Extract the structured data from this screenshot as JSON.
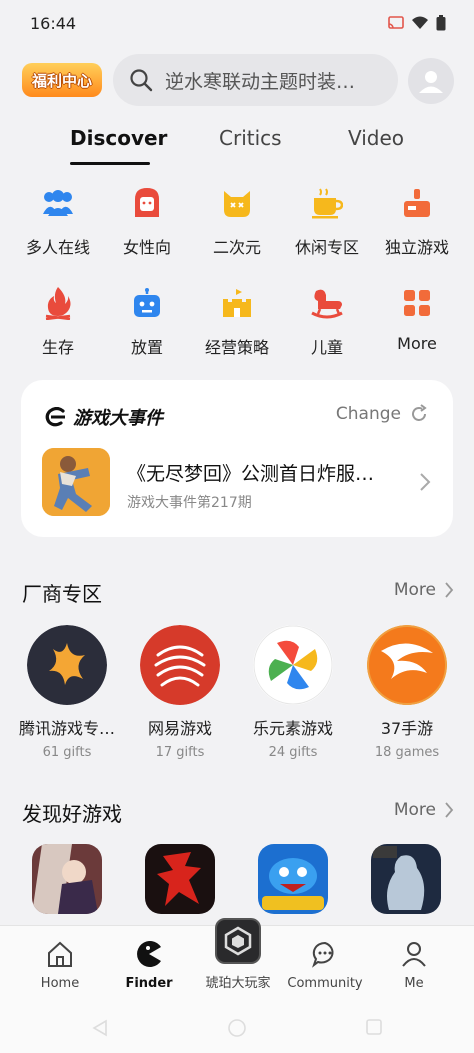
{
  "status": {
    "time": "16:44"
  },
  "header": {
    "welfare_label": "福利中心",
    "search_placeholder": "逆水寒联动主题时装…"
  },
  "tabs": [
    {
      "label": "Discover",
      "active": true
    },
    {
      "label": "Critics",
      "active": false
    },
    {
      "label": "Video",
      "active": false
    }
  ],
  "categories": [
    {
      "label": "多人在线",
      "icon": "people-icon",
      "color": "#2f86ee"
    },
    {
      "label": "女性向",
      "icon": "girl-icon",
      "color": "#e94b3c"
    },
    {
      "label": "二次元",
      "icon": "cat-icon",
      "color": "#f6b81c"
    },
    {
      "label": "休闲专区",
      "icon": "cup-icon",
      "color": "#f6b81c"
    },
    {
      "label": "独立游戏",
      "icon": "joystick-icon",
      "color": "#f26b3a"
    },
    {
      "label": "生存",
      "icon": "fire-icon",
      "color": "#e94b3c"
    },
    {
      "label": "放置",
      "icon": "robot-icon",
      "color": "#2f86ee"
    },
    {
      "label": "经营策略",
      "icon": "castle-icon",
      "color": "#f6b81c"
    },
    {
      "label": "儿童",
      "icon": "rocking-horse-icon",
      "color": "#e94b3c"
    },
    {
      "label": "More",
      "icon": "grid-icon",
      "color": "#f26b3a"
    }
  ],
  "event": {
    "brand": "游戏大事件",
    "change_label": "Change",
    "title": "《无尽梦回》公测首日炸服…",
    "subtitle": "游戏大事件第217期"
  },
  "makers_section": {
    "title": "厂商专区",
    "more_label": "More",
    "items": [
      {
        "name": "腾讯游戏专…",
        "gifts": "61 gifts"
      },
      {
        "name": "网易游戏",
        "gifts": "17 gifts"
      },
      {
        "name": "乐元素游戏",
        "gifts": "24 gifts"
      },
      {
        "name": "37手游",
        "gifts": "18 games"
      }
    ]
  },
  "games_section": {
    "title": "发现好游戏",
    "more_label": "More"
  },
  "bottom_nav": [
    {
      "label": "Home",
      "icon": "home-icon"
    },
    {
      "label": "Finder",
      "icon": "pacman-icon",
      "active": true
    },
    {
      "label": "琥珀大玩家",
      "icon": "amber-badge-icon"
    },
    {
      "label": "Community",
      "icon": "chat-icon"
    },
    {
      "label": "Me",
      "icon": "person-icon"
    }
  ]
}
